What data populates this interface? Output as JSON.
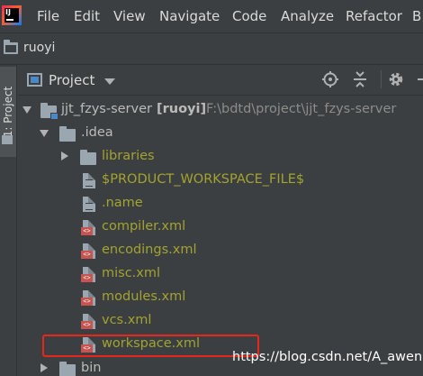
{
  "menu": [
    "File",
    "Edit",
    "View",
    "Navigate",
    "Code",
    "Analyze",
    "Refactor",
    "B"
  ],
  "breadcrumb": {
    "label": "ruoyi"
  },
  "side_tab": {
    "label": "1: Project"
  },
  "panel": {
    "title": "Project"
  },
  "tree": {
    "root": {
      "name": "jjt_fzys-server",
      "module": "[ruoyi]",
      "path": "F:\\bdtd\\project\\jjt_fzys-server"
    },
    "idea": ".idea",
    "libraries": "libraries",
    "files": [
      {
        "name": "$PRODUCT_WORKSPACE_FILE$",
        "icon": "text-file-icon"
      },
      {
        "name": ".name",
        "icon": "text-file-icon"
      },
      {
        "name": "compiler.xml",
        "icon": "xml-file-icon"
      },
      {
        "name": "encodings.xml",
        "icon": "xml-file-icon"
      },
      {
        "name": "misc.xml",
        "icon": "xml-file-icon"
      },
      {
        "name": "modules.xml",
        "icon": "xml-file-icon"
      },
      {
        "name": "vcs.xml",
        "icon": "xml-file-icon"
      },
      {
        "name": "workspace.xml",
        "icon": "xml-file-icon"
      }
    ],
    "bin": "bin"
  },
  "watermark": "https://blog.csdn.net/A_awen",
  "colors": {
    "highlight": "#e8261a",
    "file_text": "#a3a32f",
    "background": "#3c3f41"
  }
}
